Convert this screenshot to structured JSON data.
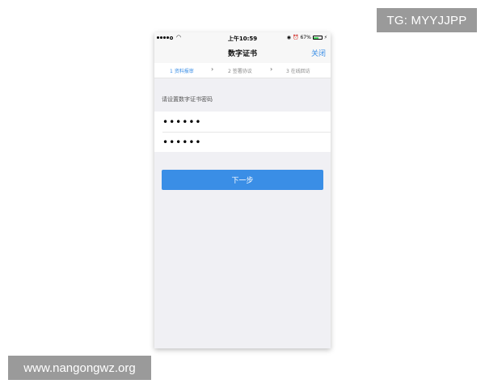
{
  "watermarks": {
    "top_right": "TG: MYYJJPP",
    "bottom_left": "www.nangongwz.org"
  },
  "status_bar": {
    "time": "上午10:59",
    "battery_percent": "67%",
    "battery_level": 0.67,
    "wifi_icon": "wifi-icon",
    "right_icons": [
      "lock-rotation-icon",
      "alarm-icon"
    ]
  },
  "nav": {
    "title": "数字证书",
    "close_label": "关闭"
  },
  "steps": {
    "items": [
      {
        "label": "1 资料报审",
        "active": true
      },
      {
        "label": "2 签署协议",
        "active": false
      },
      {
        "label": "3 在线回访",
        "active": false
      }
    ],
    "separator": "›"
  },
  "form": {
    "prompt": "请设置数字证书密码",
    "password_value": "••••••",
    "confirm_value": "••••••"
  },
  "actions": {
    "next_label": "下一步"
  },
  "colors": {
    "accent": "#3a8ee6",
    "background": "#f0f0f4",
    "battery": "#4cd964"
  }
}
